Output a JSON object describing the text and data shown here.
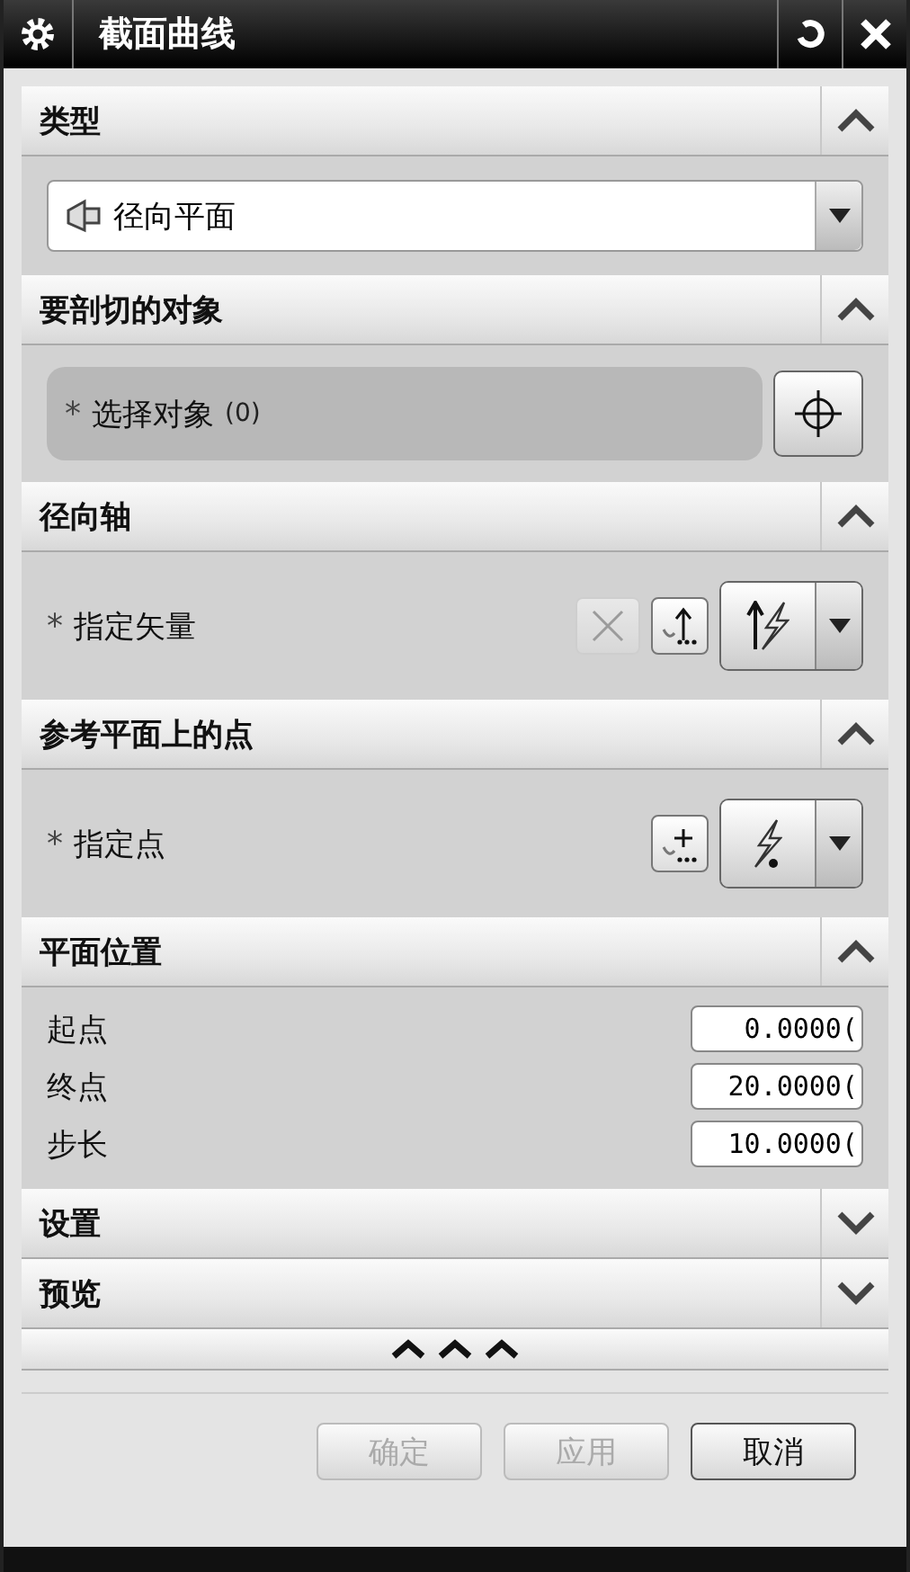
{
  "window": {
    "title": "截面曲线"
  },
  "sections": [
    {
      "title": "类型",
      "expanded": true,
      "kind": "dropdown",
      "value": "径向平面"
    },
    {
      "title": "要剖切的对象",
      "expanded": true,
      "kind": "select",
      "marker": "*",
      "label": "选择对象",
      "count": "(0)"
    },
    {
      "title": "径向轴",
      "expanded": true,
      "kind": "vector",
      "marker": "*",
      "label": "指定矢量",
      "reverse_disabled": true
    },
    {
      "title": "参考平面上的点",
      "expanded": true,
      "kind": "point",
      "marker": "*",
      "label": "指定点"
    },
    {
      "title": "平面位置",
      "expanded": true,
      "kind": "fields",
      "rows": [
        {
          "label": "起点",
          "value": "0.0000("
        },
        {
          "label": "终点",
          "value": "20.0000("
        },
        {
          "label": "步长",
          "value": "10.0000("
        }
      ]
    },
    {
      "title": "设置",
      "expanded": false
    },
    {
      "title": "预览",
      "expanded": false
    }
  ],
  "buttons": [
    {
      "label": "确定",
      "disabled": true
    },
    {
      "label": "应用",
      "disabled": true
    },
    {
      "label": "取消",
      "disabled": false
    }
  ]
}
